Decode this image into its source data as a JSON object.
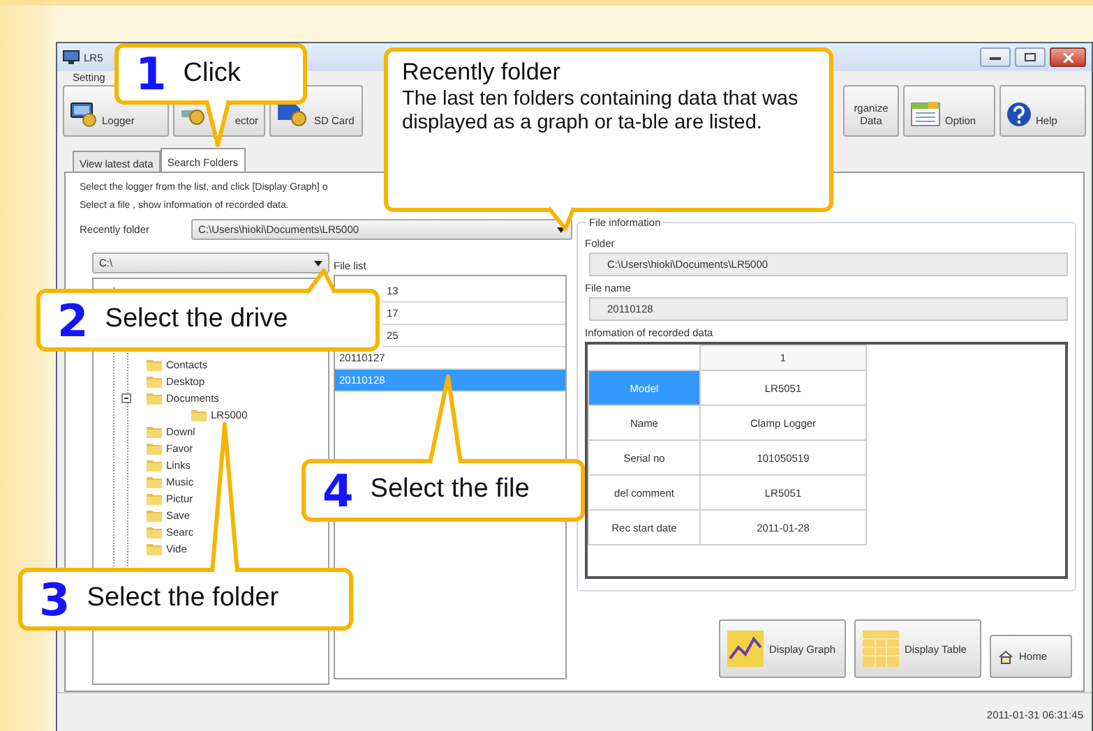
{
  "window": {
    "title": "LR5",
    "menu": [
      "Setting"
    ]
  },
  "toolbar": [
    {
      "label": "Logger",
      "kind": "logger"
    },
    {
      "label": "ector",
      "kind": "selector"
    },
    {
      "label": "SD Card",
      "kind": "sd"
    },
    {
      "label": "rganize Data",
      "kind": "organize"
    },
    {
      "label": "Option",
      "kind": "option"
    },
    {
      "label": "Help",
      "kind": "help"
    }
  ],
  "tabs": [
    {
      "label": "View latest data",
      "selected": false
    },
    {
      "label": "Search Folders",
      "selected": true
    }
  ],
  "instructions": [
    "Select the logger from the list, and click [Display Graph] o",
    "Select a file , show information of recorded data."
  ],
  "recent_folder": {
    "label": "Recently folder",
    "value": "C:\\Users\\hioki\\Documents\\LR5000"
  },
  "drive": {
    "value": "C:\\"
  },
  "tree": [
    {
      "label": "Contacts",
      "expanded": false
    },
    {
      "label": "Desktop",
      "expanded": false
    },
    {
      "label": "Documents",
      "expanded": true,
      "children": [
        {
          "label": "LR5000",
          "expanded": false
        }
      ]
    },
    {
      "label": "Downl",
      "expanded": false
    },
    {
      "label": "Favor",
      "expanded": false
    },
    {
      "label": "Links",
      "expanded": false
    },
    {
      "label": "Music",
      "expanded": false
    },
    {
      "label": "Pictur",
      "expanded": false
    },
    {
      "label": "Save",
      "expanded": false
    },
    {
      "label": "Searc",
      "expanded": false
    },
    {
      "label": "Vide",
      "expanded": false
    }
  ],
  "file_list": {
    "label": "File list",
    "items": [
      {
        "name": "13",
        "selected": false
      },
      {
        "name": "17",
        "selected": false
      },
      {
        "name": "25",
        "selected": false
      },
      {
        "name": "20110127",
        "selected": false
      },
      {
        "name": "20110128",
        "selected": true
      }
    ]
  },
  "file_information": {
    "title": "File information",
    "folder_label": "Folder",
    "folder": "C:\\Users\\hioki\\Documents\\LR5000",
    "file_name_label": "File name",
    "file_name": "20110128",
    "recorded_label": "Infomation of recorded data",
    "table": {
      "columns": [
        "1"
      ],
      "rows": [
        {
          "label": "Model",
          "value": "LR5051",
          "selected": true
        },
        {
          "label": "Name",
          "value": "Clamp Logger",
          "selected": false
        },
        {
          "label": "Serial no",
          "value": "101050519",
          "selected": false
        },
        {
          "label": "del comment",
          "value": "LR5051",
          "selected": false
        },
        {
          "label": "Rec start date",
          "value": "2011-01-28",
          "selected": false
        }
      ]
    }
  },
  "buttons": [
    {
      "label": "Display Graph",
      "kind": "graph"
    },
    {
      "label": "Display Table",
      "kind": "table"
    },
    {
      "label": "Home",
      "kind": "home"
    }
  ],
  "status_bar": {
    "time": "2011-01-31 06:31:45"
  },
  "callouts": [
    {
      "step": "1",
      "title": "Click"
    },
    {
      "title": "Recently folder",
      "body": "The last ten folders containing data that was displayed as a graph or ta-ble are listed."
    },
    {
      "step": "2",
      "title": "Select the drive"
    },
    {
      "step": "3",
      "title": "Select the folder"
    },
    {
      "step": "4",
      "title": "Select the file"
    }
  ]
}
